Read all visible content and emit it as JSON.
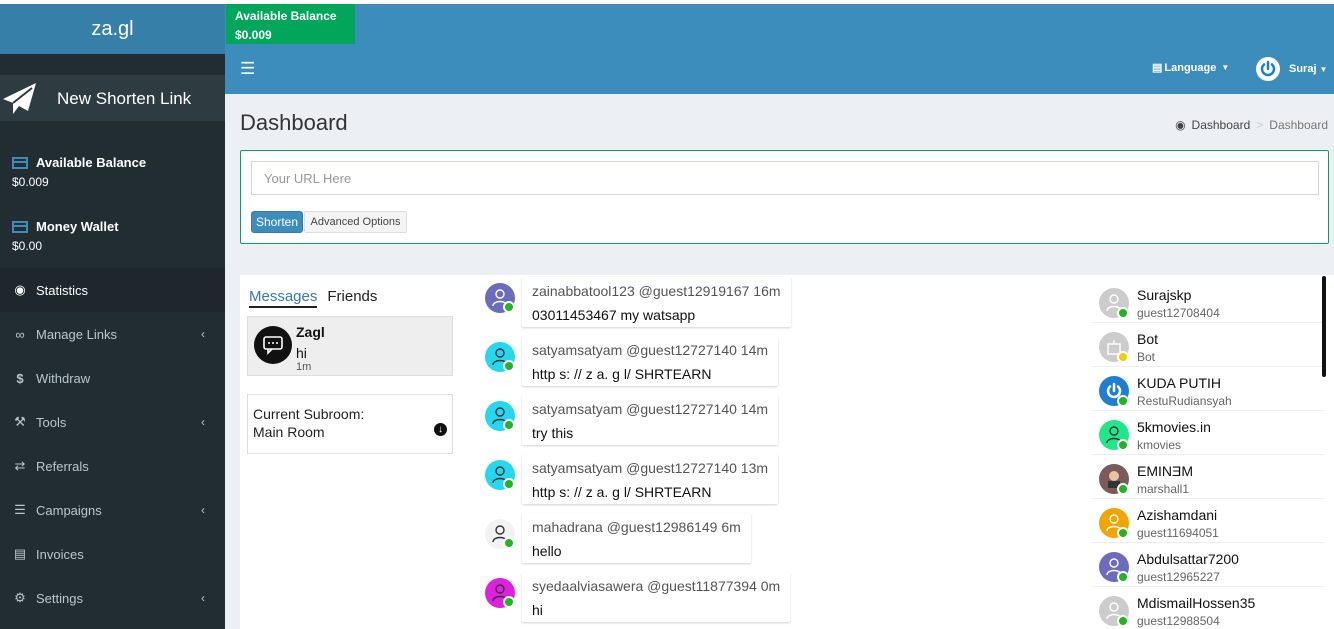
{
  "header": {
    "logo": "za.gl",
    "balance_label": "Available Balance",
    "balance_value": "$0.009",
    "language_label": "Language",
    "user_name": "Suraj"
  },
  "sidebar": {
    "new_link": "New Shorten Link",
    "available_balance": {
      "label": "Available Balance",
      "value": "$0.009"
    },
    "money_wallet": {
      "label": "Money Wallet",
      "value": "$0.00"
    },
    "items": [
      {
        "label": "Statistics",
        "icon": "dashboard-icon"
      },
      {
        "label": "Manage Links",
        "icon": "link-icon"
      },
      {
        "label": "Withdraw",
        "icon": "dollar-icon"
      },
      {
        "label": "Tools",
        "icon": "wrench-icon"
      },
      {
        "label": "Referrals",
        "icon": "exchange-icon"
      },
      {
        "label": "Campaigns",
        "icon": "database-icon"
      },
      {
        "label": "Invoices",
        "icon": "invoice-icon"
      },
      {
        "label": "Settings",
        "icon": "gears-icon"
      }
    ]
  },
  "page": {
    "title": "Dashboard",
    "breadcrumb": [
      "Dashboard",
      "Dashboard"
    ]
  },
  "shorten": {
    "placeholder": "Your URL Here",
    "shorten_button": "Shorten",
    "advanced_button": "Advanced Options"
  },
  "chat": {
    "tabs": {
      "messages": "Messages",
      "friends": "Friends"
    },
    "conversation": {
      "name": "Zagl",
      "message": "hi",
      "time": "1m"
    },
    "subroom": {
      "label": "Current Subroom:",
      "value": "Main Room"
    },
    "messages": [
      {
        "user": "zainabbatool123 @guest12919167 16m",
        "text": "03011453467 my watsapp",
        "avatar_color": "#6c6cbd"
      },
      {
        "user": "satyamsatyam @guest12727140 14m",
        "text": "http s: // z a. g l/ SHRTEARN",
        "avatar_color": "#25d8ef"
      },
      {
        "user": "satyamsatyam @guest12727140 14m",
        "text": "try this",
        "avatar_color": "#25d8ef"
      },
      {
        "user": "satyamsatyam @guest12727140 13m",
        "text": "http s: // z a. g l/ SHRTEARN",
        "avatar_color": "#25d8ef"
      },
      {
        "user": "mahadrana @guest12986149 6m",
        "text": "hello",
        "avatar_color": "#f2f2f2"
      },
      {
        "user": "syedaalviasawera @guest11877394 0m",
        "text": "hi",
        "avatar_color": "#e020e0"
      }
    ],
    "users": [
      {
        "name": "Surajskp",
        "handle": "guest12708404",
        "avatar_color": "#cccccc",
        "status": "#22b422"
      },
      {
        "name": "Bot",
        "handle": "Bot",
        "avatar_color": "#cccccc",
        "status": "#f0d000"
      },
      {
        "name": "KUDA PUTIH",
        "handle": "RestuRudiansyah",
        "avatar_color": "#1e7fd0",
        "status": "#22b422"
      },
      {
        "name": "5kmovies.in",
        "handle": "kmovies",
        "avatar_color": "#20e88a",
        "status": "#22b422"
      },
      {
        "name": "EMINƎM",
        "handle": "marshall1",
        "avatar_color": "#7a5a5a",
        "status": "#22b422"
      },
      {
        "name": "Azishamdani",
        "handle": "guest11694051",
        "avatar_color": "#f2a400",
        "status": "#22b422"
      },
      {
        "name": "Abdulsattar7200",
        "handle": "guest12965227",
        "avatar_color": "#6c6cbd",
        "status": "#22b422"
      },
      {
        "name": "MdismailHossen35",
        "handle": "guest12988504",
        "avatar_color": "#cccccc",
        "status": "#22b422"
      }
    ]
  },
  "colors": {
    "header": "#3c8dbc",
    "sidebar": "#222d32",
    "balance_badge": "#00a65a"
  }
}
